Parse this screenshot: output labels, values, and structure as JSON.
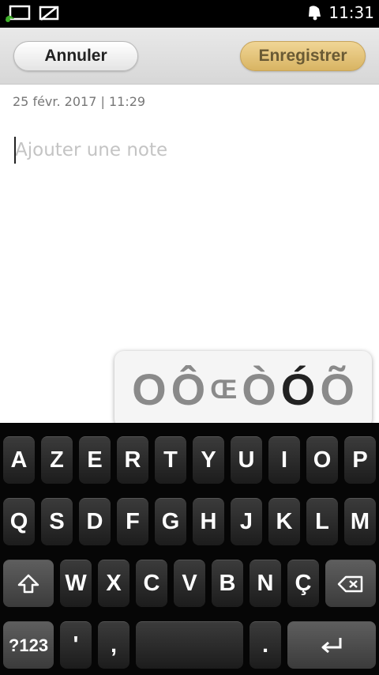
{
  "status_bar": {
    "time": "11:31",
    "icons": [
      "screen-cast-icon",
      "no-sim-icon",
      "notification-bell-icon"
    ]
  },
  "action_bar": {
    "cancel_label": "Annuler",
    "save_label": "Enregistrer"
  },
  "note": {
    "timestamp": "25 févr. 2017 | 11:29",
    "placeholder": "Ajouter une note",
    "value": ""
  },
  "accent_popup": {
    "characters": [
      "O",
      "Ô",
      "Œ",
      "Ò",
      "Ó",
      "Õ"
    ],
    "selected": "Ó"
  },
  "keyboard": {
    "row1": [
      "A",
      "Z",
      "E",
      "R",
      "T",
      "Y",
      "U",
      "I",
      "O",
      "P"
    ],
    "row2": [
      "Q",
      "S",
      "D",
      "F",
      "G",
      "H",
      "J",
      "K",
      "L",
      "M"
    ],
    "row3": [
      "W",
      "X",
      "C",
      "V",
      "B",
      "N",
      "Ç"
    ],
    "row4": {
      "symbols": "?123",
      "apostrophe": "'",
      "comma": ",",
      "period": "."
    },
    "icons": {
      "shift": "shift-icon",
      "backspace": "backspace-icon",
      "enter": "enter-icon"
    }
  }
}
